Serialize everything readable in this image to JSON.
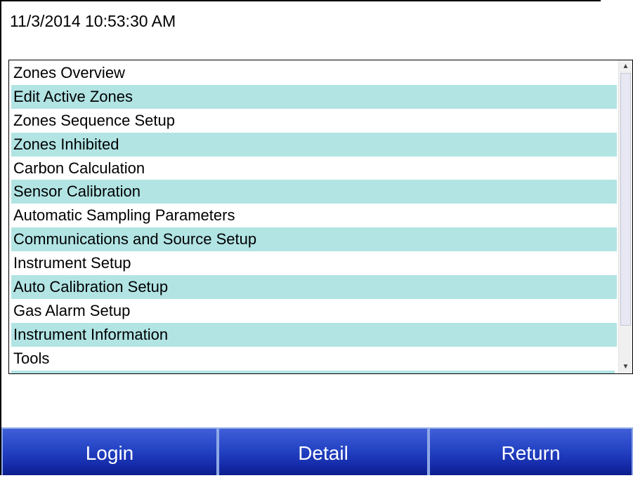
{
  "header": {
    "datetime": "11/3/2014 10:53:30 AM"
  },
  "menu": {
    "items": [
      "Zones Overview",
      "Edit Active Zones",
      "Zones Sequence Setup",
      "Zones Inhibited",
      "Carbon Calculation",
      "Sensor Calibration",
      "Automatic Sampling Parameters",
      "Communications and Source Setup",
      "Instrument Setup",
      "Auto Calibration Setup",
      "Gas Alarm Setup",
      "Instrument Information",
      "Tools"
    ],
    "alt_row_color": "#b2e4e4"
  },
  "buttons": {
    "login": "Login",
    "detail": "Detail",
    "return": "Return"
  },
  "colors": {
    "button_top": "#3f5fd8",
    "button_bottom": "#0c1e8c",
    "button_border": "#8fa8e6"
  }
}
